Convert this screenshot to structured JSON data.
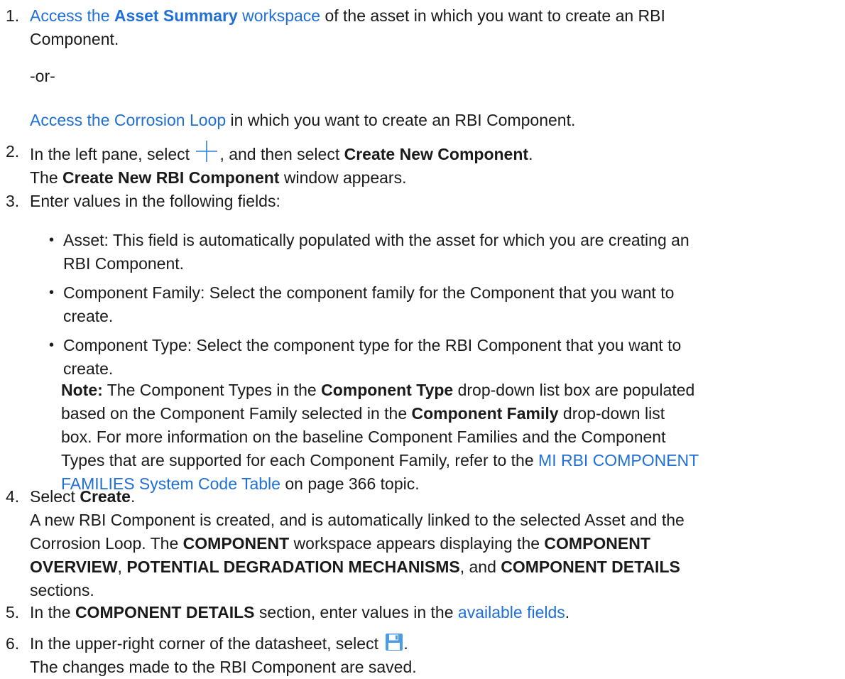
{
  "steps": [
    {
      "num": "1.",
      "link1_pre": "Access the ",
      "link1_bold": "Asset Summary",
      "link1_post": " workspace",
      "text1": " of the asset in which you want to create an RBI",
      "text1b": "Component.",
      "or": "-or-",
      "link2": "Access the Corrosion Loop",
      "text2": " in which you want to create an RBI Component."
    },
    {
      "num": "2.",
      "pre": "In the left pane, select ",
      "icon": "plus-icon",
      "mid": ", and then select ",
      "bold": "Create New Component",
      "end": ".",
      "line2_pre": "The ",
      "line2_bold": "Create New RBI Component",
      "line2_post": " window appears."
    },
    {
      "num": "3.",
      "text": "Enter values in the following fields:",
      "bullets": [
        {
          "l1": "Asset: This field is automatically populated with the asset for which you are creating an",
          "l2": "RBI Component."
        },
        {
          "l1": "Component Family: Select the component family for the Component that you want to",
          "l2": "create."
        },
        {
          "l1": "Component Type: Select the component type for the RBI Component that you want to",
          "l2": "create."
        }
      ],
      "note": {
        "label": "Note:",
        "t1": " The Component Types in the ",
        "b1": "Component Type",
        "t2": " drop-down list box are populated",
        "t3": "based on the Component Family selected in the ",
        "b2": "Component Family",
        "t4": " drop-down list",
        "l3": "box. For more information on the baseline Component Families and the Component",
        "l4": "Types that are supported for each Component Family, refer to the ",
        "link_a": "MI RBI COMPONENT",
        "link_b": "FAMILIES System Code Table",
        "l5_post": " on page 366 topic."
      }
    },
    {
      "num": "4.",
      "pre": "Select ",
      "bold": "Create",
      "end": ".",
      "l2": "A new RBI Component is created, and is automatically linked to the selected Asset and the",
      "l3_pre": "Corrosion Loop. The ",
      "l3_b1": "COMPONENT",
      "l3_mid": " workspace appears displaying the ",
      "l3_b2": "COMPONENT",
      "l4_b1": "OVERVIEW",
      "l4_c1": ", ",
      "l4_b2": "POTENTIAL DEGRADATION MECHANISMS",
      "l4_c2": ", and ",
      "l4_b3": "COMPONENT DETAILS",
      "l5": "sections."
    },
    {
      "num": "5.",
      "pre": "In the ",
      "bold": "COMPONENT DETAILS",
      "mid": " section, enter values in the ",
      "link": "available fields",
      "end": "."
    },
    {
      "num": "6.",
      "pre": "In the upper-right corner of the datasheet, select ",
      "icon": "save-icon",
      "end": ".",
      "l2": "The changes made to the RBI Component are saved."
    }
  ]
}
